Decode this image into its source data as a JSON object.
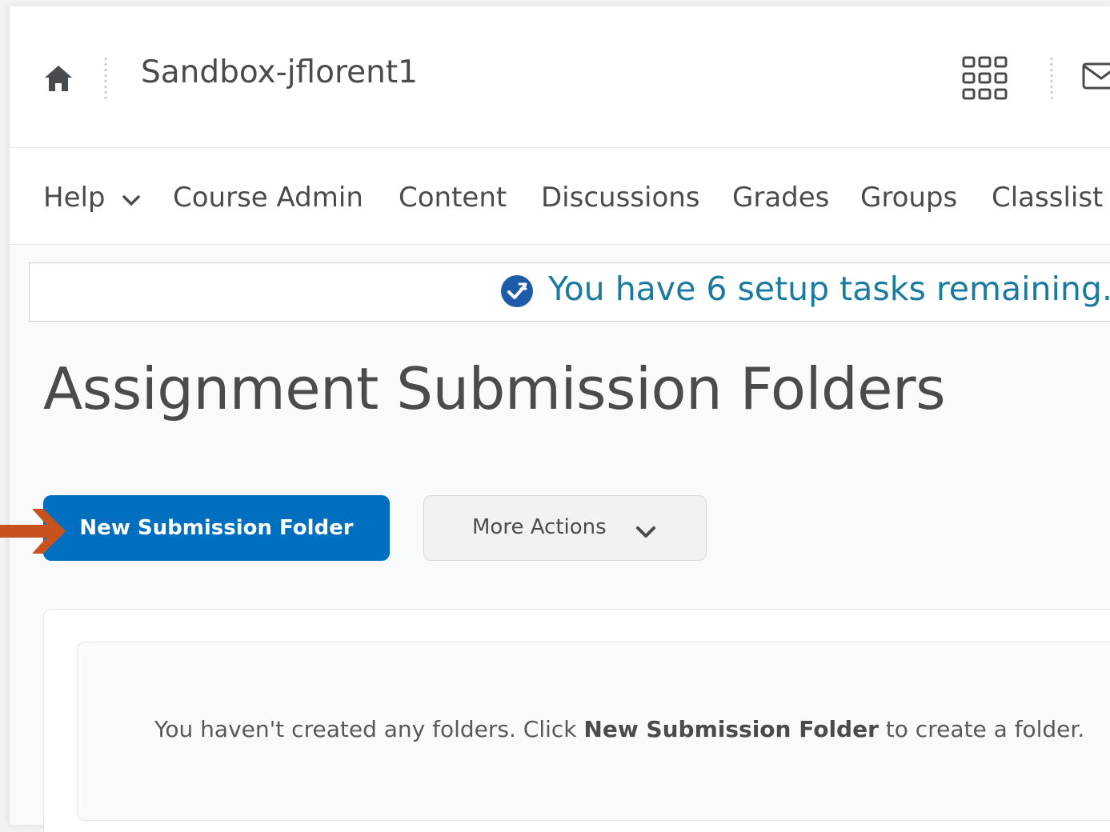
{
  "header": {
    "course_title": "Sandbox-jflorent1",
    "icons": [
      "home-icon",
      "waffle-icon",
      "mail-icon"
    ]
  },
  "nav": {
    "items": [
      {
        "label": "Help"
      },
      {
        "label": "Course Admin"
      },
      {
        "label": "Content"
      },
      {
        "label": "Discussions"
      },
      {
        "label": "Grades"
      },
      {
        "label": "Groups"
      },
      {
        "label": "Classlist"
      }
    ]
  },
  "setup_banner": {
    "text": "You have 6 setup tasks remaining."
  },
  "page": {
    "title": "Assignment Submission Folders"
  },
  "actions": {
    "new_folder_label": "New Submission Folder",
    "more_actions_label": "More Actions"
  },
  "empty_state": {
    "prefix": "You haven't created any folders. Click ",
    "emphasis": "New Submission Folder",
    "suffix": " to create a folder."
  },
  "colors": {
    "primary": "#006fbf",
    "banner_text": "#1a7aa0",
    "annotation_arrow": "#c8521e"
  }
}
